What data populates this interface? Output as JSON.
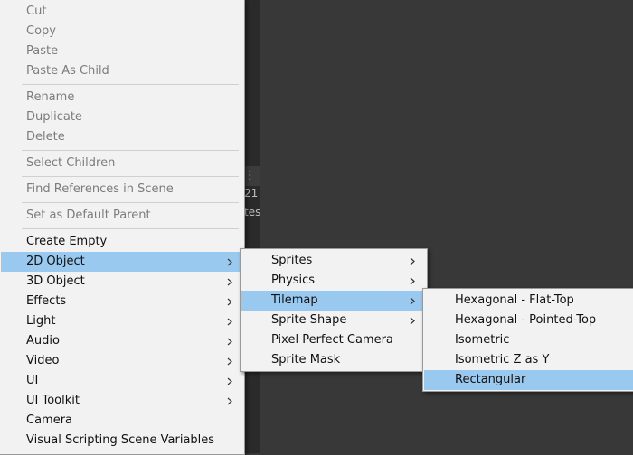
{
  "background": {
    "row_number": "21",
    "row_text": "tes"
  },
  "main_menu": {
    "items": [
      {
        "label": "Cut",
        "disabled": true
      },
      {
        "label": "Copy",
        "disabled": true
      },
      {
        "label": "Paste",
        "disabled": true
      },
      {
        "label": "Paste As Child",
        "disabled": true
      },
      {
        "label": "Rename",
        "disabled": true
      },
      {
        "label": "Duplicate",
        "disabled": true
      },
      {
        "label": "Delete",
        "disabled": true
      },
      {
        "label": "Select Children",
        "disabled": true
      },
      {
        "label": "Find References in Scene",
        "disabled": true
      },
      {
        "label": "Set as Default Parent",
        "disabled": true
      },
      {
        "label": "Create Empty"
      },
      {
        "label": "2D Object",
        "submenu": true,
        "highlighted": true
      },
      {
        "label": "3D Object",
        "submenu": true
      },
      {
        "label": "Effects",
        "submenu": true
      },
      {
        "label": "Light",
        "submenu": true
      },
      {
        "label": "Audio",
        "submenu": true
      },
      {
        "label": "Video",
        "submenu": true
      },
      {
        "label": "UI",
        "submenu": true
      },
      {
        "label": "UI Toolkit",
        "submenu": true
      },
      {
        "label": "Camera"
      },
      {
        "label": "Visual Scripting Scene Variables"
      }
    ]
  },
  "submenu_2d": {
    "items": [
      {
        "label": "Sprites",
        "submenu": true
      },
      {
        "label": "Physics",
        "submenu": true
      },
      {
        "label": "Tilemap",
        "submenu": true,
        "highlighted": true
      },
      {
        "label": "Sprite Shape",
        "submenu": true
      },
      {
        "label": "Pixel Perfect Camera"
      },
      {
        "label": "Sprite Mask"
      }
    ]
  },
  "submenu_tilemap": {
    "items": [
      {
        "label": "Hexagonal - Flat-Top"
      },
      {
        "label": "Hexagonal - Pointed-Top"
      },
      {
        "label": "Isometric"
      },
      {
        "label": "Isometric Z as Y"
      },
      {
        "label": "Rectangular",
        "highlighted": true
      }
    ]
  },
  "colors": {
    "menu_bg": "#f2f2f2",
    "highlight": "#99c9ef",
    "disabled_text": "#7c7c7c",
    "text": "#101010",
    "editor_bg": "#383838"
  }
}
